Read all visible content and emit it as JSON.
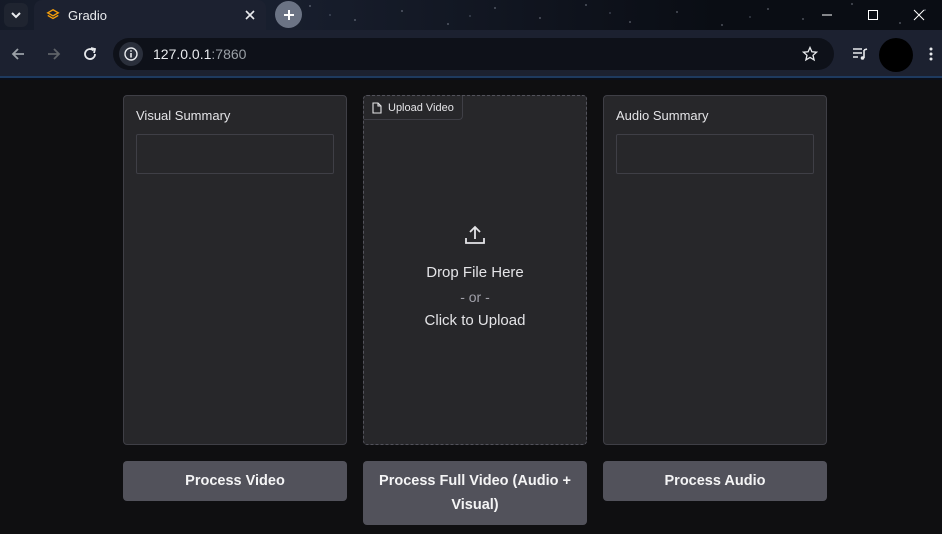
{
  "browser": {
    "tab": {
      "title": "Gradio"
    },
    "url": {
      "host": "127.0.0.1",
      "port": ":7860"
    }
  },
  "app": {
    "visual_summary": {
      "label": "Visual Summary",
      "value": ""
    },
    "upload": {
      "tag_label": "Upload Video",
      "drop_text": "Drop File Here",
      "or_text": "- or -",
      "click_text": "Click to Upload"
    },
    "audio_summary": {
      "label": "Audio Summary",
      "value": ""
    },
    "buttons": {
      "process_video": "Process Video",
      "process_full": "Process Full Video (Audio + Visual)",
      "process_audio": "Process Audio"
    }
  }
}
